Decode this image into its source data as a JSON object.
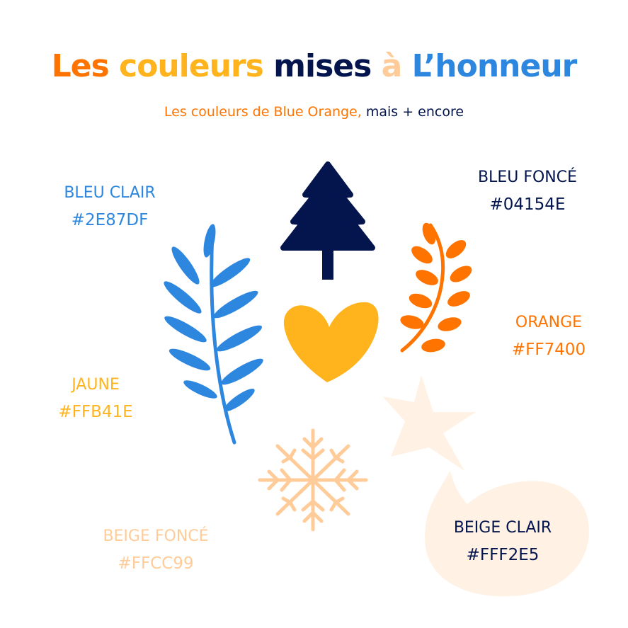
{
  "colors": {
    "bleu_clair": "#2E87DF",
    "bleu_fonce": "#04154E",
    "orange": "#FF7400",
    "jaune": "#FFB41E",
    "beige_fonce": "#FFCC99",
    "beige_clair": "#FFF2E5"
  },
  "title": {
    "word1": "Les",
    "word2": "couleurs",
    "word3": "mises",
    "word4": "à",
    "word5": "L’honneur"
  },
  "subtitle": {
    "part1": "Les couleurs de Blue Orange,",
    "part2": "mais + encore"
  },
  "swatches": [
    {
      "name": "BLEU CLAIR",
      "code": "#2E87DF",
      "icon": "fern-leaf-icon"
    },
    {
      "name": "BLEU FONCÉ",
      "code": "#04154E",
      "icon": "pine-tree-icon"
    },
    {
      "name": "ORANGE",
      "code": "#FF7400",
      "icon": "orange-branch-icon"
    },
    {
      "name": "JAUNE",
      "code": "#FFB41E",
      "icon": "heart-icon"
    },
    {
      "name": "BEIGE FONCÉ",
      "code": "#FFCC99",
      "icon": "snowflake-icon"
    },
    {
      "name": "BEIGE CLAIR",
      "code": "#FFF2E5",
      "icon": "speech-bubble-icon"
    }
  ]
}
